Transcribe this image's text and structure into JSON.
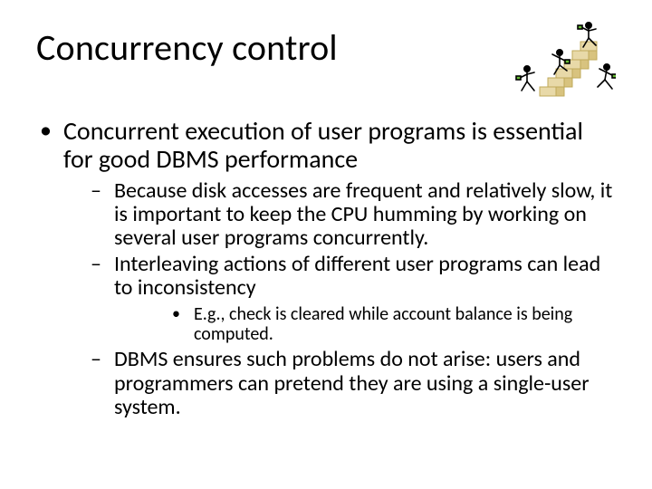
{
  "title": "Concurrency control",
  "bullets": {
    "lvl1_0": "Concurrent execution of user programs is essential for good DBMS performance",
    "lvl2_0": "Because disk accesses are frequent and relatively slow, it is important to keep the CPU humming by working on several user programs concurrently.",
    "lvl2_1": " Interleaving actions of different user programs can lead to inconsistency",
    "lvl3_0": "E.g., check is cleared while account balance is being computed.",
    "lvl2_2": " DBMS ensures such problems do not arise: users and programmers can pretend they are using a single-user system."
  }
}
